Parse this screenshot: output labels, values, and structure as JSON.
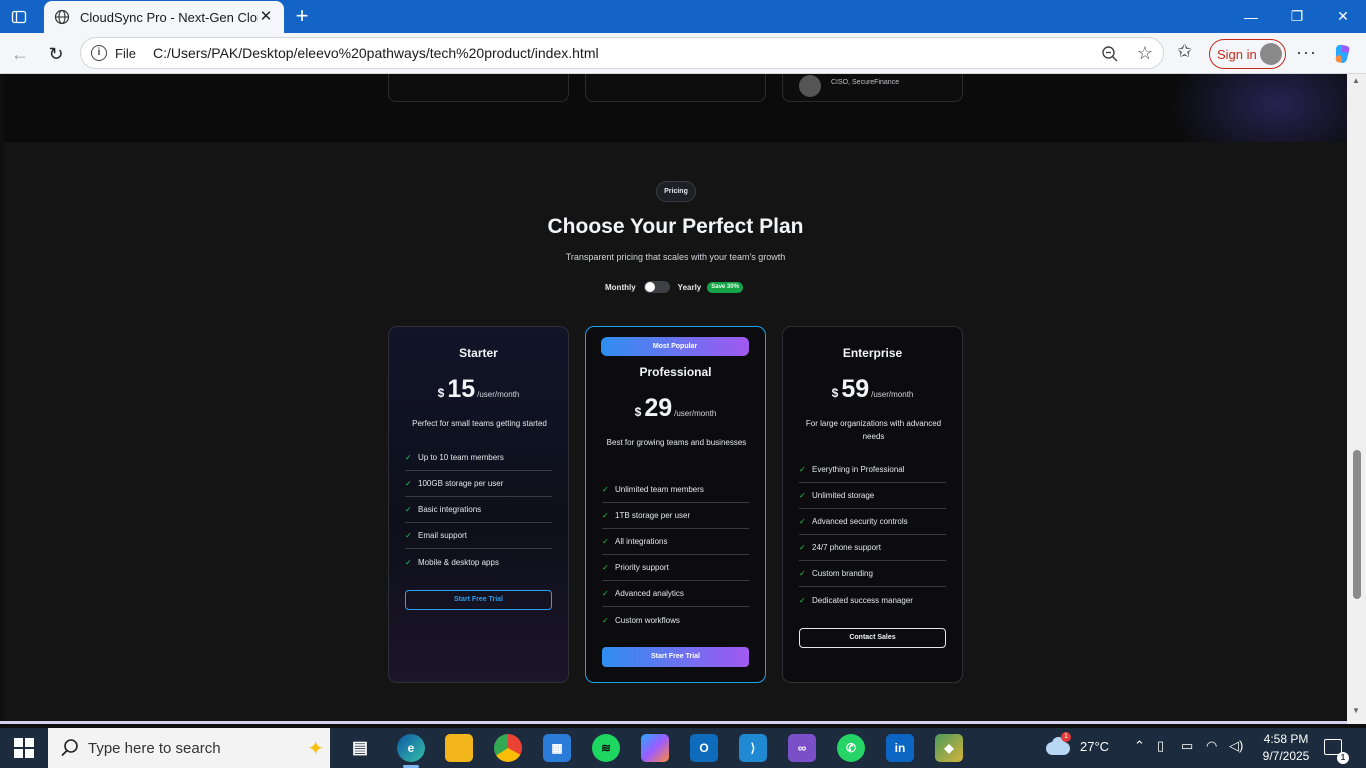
{
  "browser": {
    "tab_title": "CloudSync Pro - Next-Gen Cloud",
    "new_tab_label": "+",
    "address_prefix": "File",
    "url": "C:/Users/PAK/Desktop/eleevo%20pathways/tech%20product/index.html",
    "signin_label": "Sign in",
    "accent_color": "#1464c8"
  },
  "testimonials": {
    "visible_author_role": "CISO, SecureFinance"
  },
  "pricing": {
    "badge": "Pricing",
    "heading": "Choose Your Perfect Plan",
    "subheading": "Transparent pricing that scales with your team's growth",
    "toggle": {
      "monthly_label": "Monthly",
      "yearly_label": "Yearly",
      "save_badge": "Save 30%",
      "selected": "monthly"
    },
    "currency": "$",
    "per_label": "/user/month",
    "plans": [
      {
        "name": "Starter",
        "price": "15",
        "description": "Perfect for small teams getting started",
        "features": [
          "Up to 10 team members",
          "100GB storage per user",
          "Basic integrations",
          "Email support",
          "Mobile & desktop apps"
        ],
        "cta": "Start Free Trial"
      },
      {
        "name": "Professional",
        "badge": "Most Popular",
        "price": "29",
        "description": "Best for growing teams and businesses",
        "features": [
          "Unlimited team members",
          "1TB storage per user",
          "All integrations",
          "Priority support",
          "Advanced analytics",
          "Custom workflows"
        ],
        "cta": "Start Free Trial"
      },
      {
        "name": "Enterprise",
        "price": "59",
        "description": "For large organizations with advanced needs",
        "features": [
          "Everything in Professional",
          "Unlimited storage",
          "Advanced security controls",
          "24/7 phone support",
          "Custom branding",
          "Dedicated success manager"
        ],
        "cta": "Contact Sales"
      }
    ],
    "colors": {
      "check": "#22c55e",
      "gradient_start": "#2f8ef0",
      "gradient_end": "#a259f0",
      "highlight_border": "#1aa3e8"
    }
  },
  "taskbar": {
    "search_placeholder": "Type here to search",
    "weather_temp": "27°C",
    "weather_badge": "1",
    "time": "4:58 PM",
    "date": "9/7/2025",
    "notification_count": "1",
    "apps": [
      "task-view",
      "edge",
      "file-explorer",
      "chrome",
      "microsoft-store",
      "spotify",
      "copilot",
      "outlook",
      "vs-code",
      "visual-studio",
      "whatsapp",
      "linkedin",
      "git-client"
    ]
  }
}
